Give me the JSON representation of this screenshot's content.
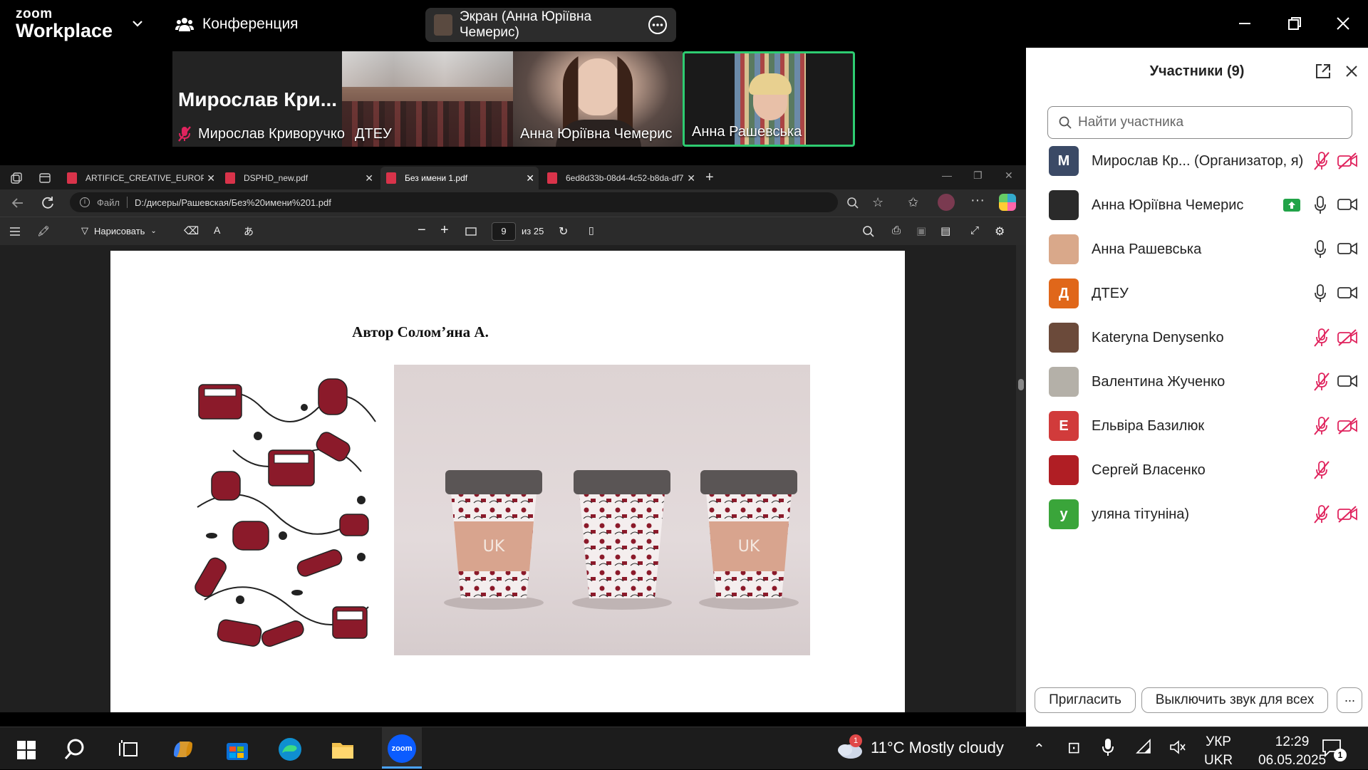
{
  "zoom": {
    "logo_line1": "zoom",
    "logo_line2": "Workplace",
    "meeting_label": "Конференция",
    "screen_share_label": "Экран (Анна Юріївна Чемерис)"
  },
  "video_tiles": [
    {
      "big_name": "Мирослав Кри...",
      "name": "Мирослав Криворучко",
      "muted": true
    },
    {
      "name": "ДТЕУ"
    },
    {
      "name": "Анна Юріївна Чемерис"
    },
    {
      "name": "Анна Рашевська",
      "active_speaker": true
    }
  ],
  "browser": {
    "tabs": [
      {
        "label": "ARTIFICE_CREATIVE_EUROPE_WP..."
      },
      {
        "label": "DSPHD_new.pdf"
      },
      {
        "label": "Без имени 1.pdf",
        "active": true
      },
      {
        "label": "6ed8d33b-08d4-4c52-b8da-df7d..."
      }
    ],
    "file_label": "Файл",
    "url": "D:/дисеры/Рашевская/Без%20имени%201.pdf"
  },
  "pdf": {
    "draw_label": "Нарисовать",
    "current_page": "9",
    "page_total": "из 25",
    "page_title": "Автор Солом’яна А."
  },
  "participants": {
    "title": "Участники (9)",
    "search_placeholder": "Найти участника",
    "list": [
      {
        "name": "Мирослав Кр...  (Организатор, я)",
        "initial": "М",
        "color": "#3b4a66",
        "mic": "muted",
        "cam": "off"
      },
      {
        "name": "Анна Юріївна Чемерис",
        "initial": "",
        "color": "#2a2a2a",
        "mic": "on",
        "cam": "on",
        "sharing": true
      },
      {
        "name": "Анна Рашевська",
        "initial": "",
        "color": "#d9a88a",
        "mic": "on",
        "cam": "on"
      },
      {
        "name": "ДТЕУ",
        "initial": "Д",
        "color": "#e0671a",
        "mic": "on",
        "cam": "on"
      },
      {
        "name": "Kateryna Denysenko",
        "initial": "",
        "color": "#6b4a3a",
        "mic": "muted",
        "cam": "off"
      },
      {
        "name": "Валентина Жученко",
        "initial": "",
        "color": "#b4b0a8",
        "mic": "muted",
        "cam": "on"
      },
      {
        "name": "Ельвіра Базилюк",
        "initial": "Е",
        "color": "#d13b3b",
        "mic": "muted",
        "cam": "off"
      },
      {
        "name": "Сергей Власенко",
        "initial": "",
        "color": "#b01e24",
        "mic": "muted",
        "cam": "none"
      },
      {
        "name": "уляна тітуніна)",
        "initial": "у",
        "color": "#3aa53a",
        "mic": "muted",
        "cam": "off"
      }
    ],
    "invite_label": "Пригласить",
    "mute_all_label": "Выключить звук для всех"
  },
  "taskbar": {
    "weather_badge": "1",
    "weather": "11°C  Mostly cloudy",
    "lang_top": "УКР",
    "lang_bottom": "UKR",
    "time": "12:29",
    "date": "06.05.2025",
    "notif_count": "1"
  },
  "colors": {
    "speaker_border": "#2ecc71",
    "muted_red": "#e0245e",
    "share_green": "#21a348"
  }
}
